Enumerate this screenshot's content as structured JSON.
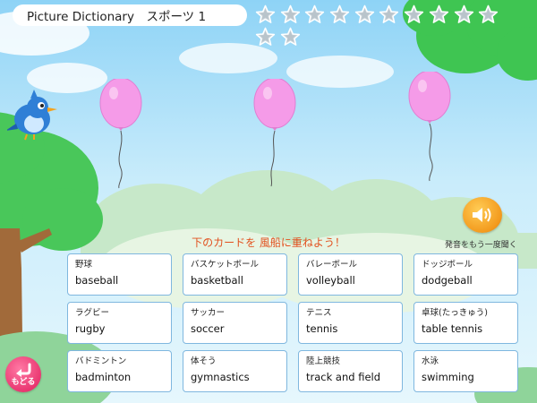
{
  "header": {
    "title": "Picture Dictionary　スポーツ 1"
  },
  "progress": {
    "stars_total": 12,
    "stars_earned": 0,
    "star_icon": "star-icon"
  },
  "balloons": {
    "count": 3,
    "color": "#f59be8"
  },
  "instruction": "下のカードを 風船に重ねよう！",
  "sound": {
    "label": "発音をもう一度聞く",
    "icon": "speaker-icon"
  },
  "cards": [
    {
      "jp": "野球",
      "en": "baseball"
    },
    {
      "jp": "バスケットボール",
      "en": "basketball"
    },
    {
      "jp": "バレーボール",
      "en": "volleyball"
    },
    {
      "jp": "ドッジボール",
      "en": "dodgeball"
    },
    {
      "jp": "ラグビー",
      "en": "rugby"
    },
    {
      "jp": "サッカー",
      "en": "soccer"
    },
    {
      "jp": "テニス",
      "en": "tennis"
    },
    {
      "jp": "卓球(たっきゅう)",
      "en": "table tennis"
    },
    {
      "jp": "バドミントン",
      "en": "badminton"
    },
    {
      "jp": "体そう",
      "en": "gymnastics"
    },
    {
      "jp": "陸上競技",
      "en": "track and field"
    },
    {
      "jp": "水泳",
      "en": "swimming"
    }
  ],
  "back": {
    "label": "もどる",
    "icon": "back-arrow-icon"
  },
  "colors": {
    "accent": "#e2511f",
    "card_border": "#7fb7df",
    "back_button": "#e8336e",
    "sound_button": "#f39a1d"
  }
}
